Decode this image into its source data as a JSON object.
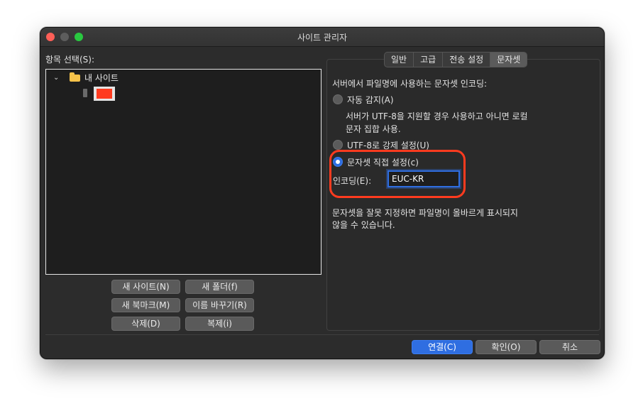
{
  "window": {
    "title": "사이트 관리자"
  },
  "left": {
    "select_label": "항목 선택(S):",
    "tree": {
      "root_label": "내 사이트"
    },
    "buttons": {
      "new_site": "새 사이트(N)",
      "new_folder": "새 폴더(f)",
      "new_bookmark": "새 북마크(M)",
      "rename": "이름 바꾸기(R)",
      "delete": "삭제(D)",
      "duplicate": "복제(i)"
    }
  },
  "tabs": [
    "일반",
    "고급",
    "전송 설정",
    "문자셋"
  ],
  "charset": {
    "heading": "서버에서 파일명에 사용하는 문자셋 인코딩:",
    "auto_label": "자동 감지(A)",
    "auto_desc_1": "서버가 UTF-8을 지원할 경우 사용하고 아니면 로컬",
    "auto_desc_2": "문자 집합 사용.",
    "utf8_label": "UTF-8로 강제 설정(U)",
    "custom_label": "문자셋 직접 설정(c)",
    "encoding_label": "인코딩(E):",
    "encoding_value": "EUC-KR",
    "warning_1": "문자셋을 잘못 지정하면 파일명이 올바르게 표시되지",
    "warning_2": "않을 수 있습니다.",
    "selected": "custom"
  },
  "footer": {
    "connect": "연결(C)",
    "ok": "확인(O)",
    "cancel": "취소"
  },
  "colors": {
    "accent": "#2f6ee1",
    "highlight": "#ff3b1f"
  }
}
